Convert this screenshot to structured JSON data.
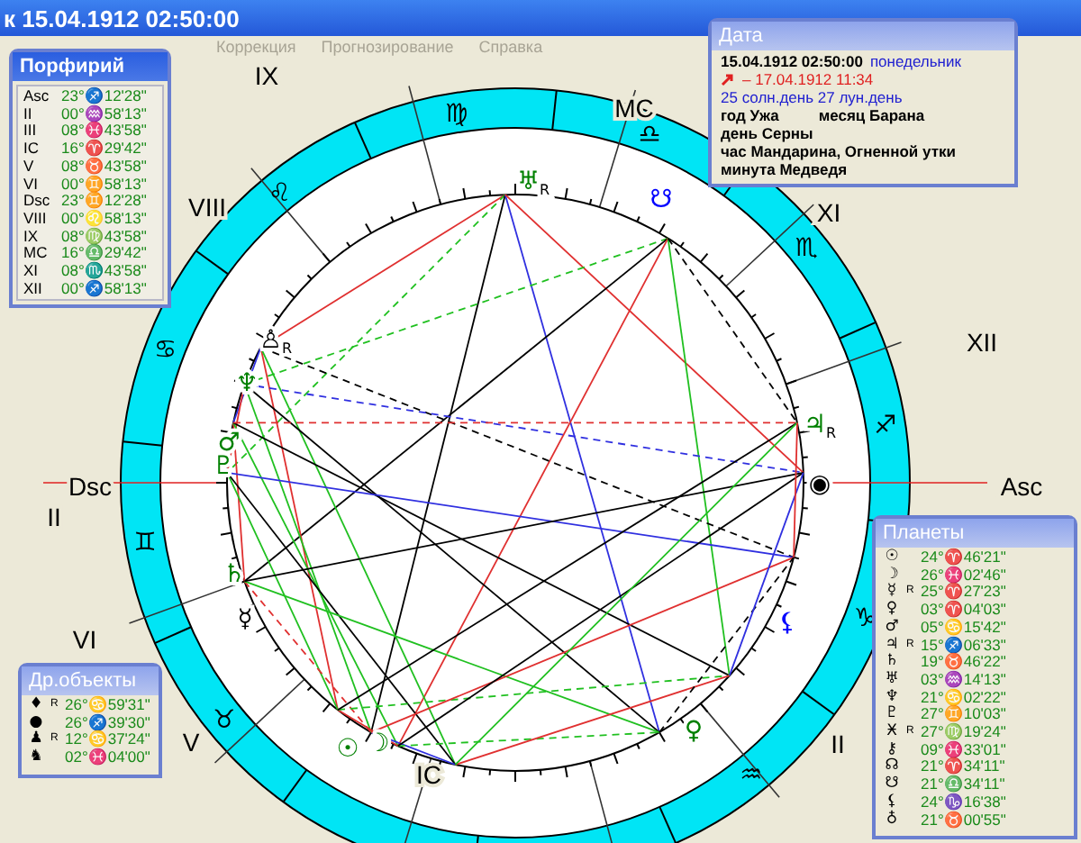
{
  "window": {
    "title": "к 15.04.1912  02:50:00"
  },
  "menu": [
    "Коррекция",
    "Прогнозирование",
    "Справка"
  ],
  "chart": {
    "signs": [
      "♉",
      "♊",
      "♋",
      "♌",
      "♍",
      "♎",
      "♏",
      "♐",
      "♑",
      "♒"
    ],
    "houses": [
      "IX",
      "MC",
      "XI",
      "VIII",
      "XII",
      "Dsc",
      "Asc",
      "II",
      "VI",
      "V",
      "IC",
      "II"
    ],
    "bodies": [
      {
        "glyph": "♅",
        "retro": "R",
        "color": "#008000"
      },
      {
        "glyph": "☋",
        "color": "#0000ff"
      },
      {
        "glyph": "♙",
        "retro": "R",
        "color": "#000000"
      },
      {
        "glyph": "♆",
        "color": "#008000"
      },
      {
        "glyph": "♂",
        "color": "#008000"
      },
      {
        "glyph": "♇",
        "color": "#008000"
      },
      {
        "glyph": "♄",
        "color": "#008000"
      },
      {
        "glyph": "☿",
        "color": "#000000"
      },
      {
        "glyph": "☉",
        "color": "#008000"
      },
      {
        "glyph": "☽",
        "color": "#008000"
      },
      {
        "glyph": "♃",
        "retro": "R",
        "color": "#008000"
      },
      {
        "glyph": "◉",
        "color": "#000000"
      },
      {
        "glyph": "⚸",
        "color": "#0000ff"
      },
      {
        "glyph": "♀",
        "color": "#008000"
      }
    ]
  },
  "houses_panel": {
    "title": "Порфирий",
    "rows": [
      {
        "label": "Asc",
        "value": "23°♐12'28\""
      },
      {
        "label": "II",
        "value": "00°♒58'13\""
      },
      {
        "label": "III",
        "value": "08°♓43'58\""
      },
      {
        "label": "IC",
        "value": "16°♈29'42\""
      },
      {
        "label": "V",
        "value": "08°♉43'58\""
      },
      {
        "label": "VI",
        "value": "00°♊58'13\""
      },
      {
        "label": "Dsc",
        "value": "23°♊12'28\""
      },
      {
        "label": "VIII",
        "value": "00°♌58'13\""
      },
      {
        "label": "IX",
        "value": "08°♍43'58\""
      },
      {
        "label": "MC",
        "value": "16°♎29'42\""
      },
      {
        "label": "XI",
        "value": "08°♏43'58\""
      },
      {
        "label": "XII",
        "value": "00°♐58'13\""
      }
    ]
  },
  "date_panel": {
    "title": "Дата",
    "datetime": "15.04.1912  02:50:00",
    "weekday": "понедельник",
    "progression": "– 17.04.1912  11:34",
    "days": "25 солн.день  27 лун.день",
    "year": "год Ужа",
    "month": "месяц Барана",
    "day": "день Серны",
    "hour": "час Мандарина, Огненной утки",
    "minute": "минута Медведя"
  },
  "planets_panel": {
    "title": "Планеты",
    "rows": [
      {
        "glyph": "☉",
        "value": "24°♈46'21\""
      },
      {
        "glyph": "☽",
        "value": "26°♓02'46\""
      },
      {
        "glyph": "☿",
        "retro": "R",
        "value": "25°♈27'23\""
      },
      {
        "glyph": "♀",
        "value": "03°♈04'03\""
      },
      {
        "glyph": "♂",
        "value": "05°♋15'42\""
      },
      {
        "glyph": "♃",
        "retro": "R",
        "value": "15°♐06'33\""
      },
      {
        "glyph": "♄",
        "value": "19°♉46'22\""
      },
      {
        "glyph": "♅",
        "value": "03°♒14'13\""
      },
      {
        "glyph": "♆",
        "value": "21°♋02'22\""
      },
      {
        "glyph": "♇",
        "value": "27°♊10'03\""
      },
      {
        "glyph": "Ӿ",
        "retro": "R",
        "value": "27°♍19'24\""
      },
      {
        "glyph": "⚷",
        "value": "09°♓33'01\""
      },
      {
        "glyph": "☊",
        "value": "21°♈34'11\""
      },
      {
        "glyph": "☋",
        "value": "21°♎34'11\""
      },
      {
        "glyph": "⚸",
        "value": "24°♑16'38\""
      },
      {
        "glyph": "♁",
        "value": "21°♉00'55\""
      }
    ]
  },
  "objects_panel": {
    "title": "Др.объекты",
    "rows": [
      {
        "glyph": "♦",
        "retro": "R",
        "value": "26°♋59'31\""
      },
      {
        "glyph": "●",
        "value": "26°♐39'30\""
      },
      {
        "glyph": "♟",
        "retro": "R",
        "value": "12°♋37'24\""
      },
      {
        "glyph": "♞",
        "value": "02°♓04'00\""
      }
    ]
  }
}
